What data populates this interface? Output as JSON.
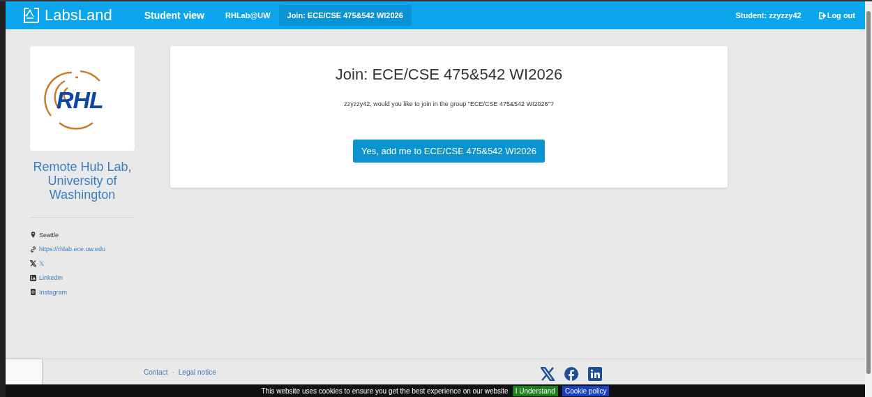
{
  "navbar": {
    "brand": "LabsLand",
    "items": [
      {
        "label": "Student view",
        "kind": "title",
        "selected": false
      },
      {
        "label": "RHLab@UW",
        "kind": "link",
        "selected": false
      },
      {
        "label": "Join: ECE/CSE 475&542 WI2026",
        "kind": "link",
        "selected": true
      }
    ],
    "user": "Student: zzyzzy42",
    "logout": "Log out"
  },
  "sidebar": {
    "logo_text": "RHL",
    "name": "Remote Hub Lab, University of Washington",
    "links": [
      {
        "kind": "location",
        "label": "Seattle"
      },
      {
        "kind": "link",
        "label": "https://rhlab.ece.uw.edu"
      },
      {
        "kind": "x",
        "label": "𝕏"
      },
      {
        "kind": "linkedin",
        "label": "LinkedIn"
      },
      {
        "kind": "instagram",
        "label": "Instagram"
      }
    ]
  },
  "card": {
    "title": "Join: ECE/CSE 475&542 WI2026",
    "message": "zzyzzy42, would you like to join in the group \"ECE/CSE 475&542 WI2026\"?",
    "button": "Yes, add me to ECE/CSE 475&542 WI2026"
  },
  "footer": {
    "links": [
      "Contact",
      "Legal notice"
    ],
    "separator": "·",
    "social": [
      {
        "kind": "x"
      },
      {
        "kind": "facebook"
      },
      {
        "kind": "linkedin"
      }
    ]
  },
  "cookie_bar": {
    "message": "This website uses cookies to ensure you get the best experience on our website",
    "accept": "I Understand",
    "policy": "Cookie policy"
  }
}
